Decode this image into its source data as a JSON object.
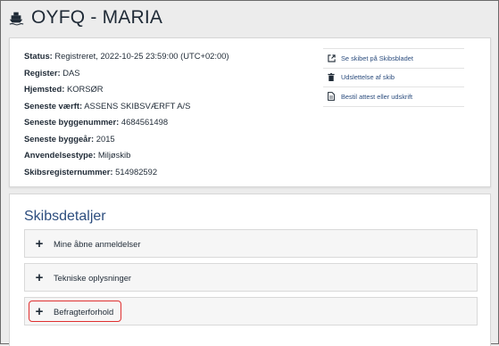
{
  "header": {
    "title": "OYFQ - MARIA",
    "icon": "ship-icon"
  },
  "info": {
    "rows": [
      {
        "label": "Status:",
        "value": "Registreret, 2022-10-25 23:59:00 (UTC+02:00)"
      },
      {
        "label": "Register:",
        "value": "DAS"
      },
      {
        "label": "Hjemsted:",
        "value": "KORSØR"
      },
      {
        "label": "Seneste værft:",
        "value": "ASSENS SKIBSVÆRFT A/S"
      },
      {
        "label": "Seneste byggenummer:",
        "value": "4684561498"
      },
      {
        "label": "Seneste byggeår:",
        "value": "2015"
      },
      {
        "label": "Anvendelsestype:",
        "value": "Miljøskib"
      },
      {
        "label": "Skibsregisternummer:",
        "value": "514982592"
      }
    ]
  },
  "actions": [
    {
      "label": "Se skibet på Skibsbladet",
      "icon": "external-link-icon"
    },
    {
      "label": "Udslettelse af skib",
      "icon": "trash-icon"
    },
    {
      "label": "Bestil attest eller udskrift",
      "icon": "document-icon"
    }
  ],
  "details": {
    "title": "Skibsdetaljer",
    "accordions": [
      {
        "label": "Mine åbne anmeldelser",
        "icon": "+"
      },
      {
        "label": "Tekniske oplysninger",
        "icon": "+"
      },
      {
        "label": "Befragterforhold",
        "icon": "+"
      }
    ]
  }
}
